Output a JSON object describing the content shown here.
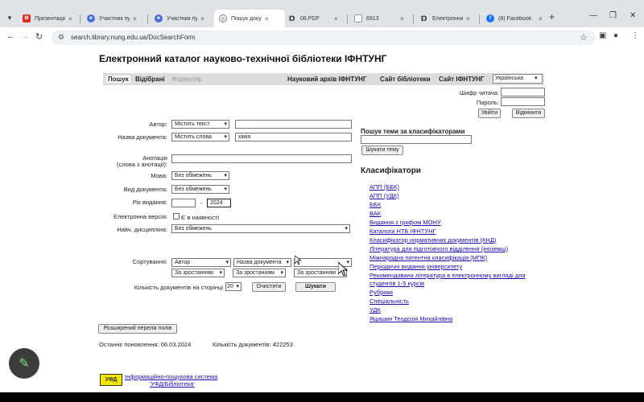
{
  "tabs": [
    {
      "title": "Презентація"
    },
    {
      "title": "Участник пуб"
    },
    {
      "title": "Участник пуб"
    },
    {
      "title": "Пошук докум",
      "active": true
    },
    {
      "title": "08.PDF"
    },
    {
      "title": "6913"
    },
    {
      "title": "Електронний"
    },
    {
      "title": "(8) Facebook"
    }
  ],
  "url": "search.library.nung.edu.ua/DocSearchForm",
  "page": {
    "title": "Електронний каталог науково-технічної бібліотеки ІФНТУНГ",
    "nav": {
      "search": "Пошук",
      "favorites": "Відібрані",
      "form": "Формуляр",
      "archive": "Науковий архів ІФНТУНГ",
      "library_site": "Сайт бібліотеки",
      "ifntung_site": "Сайт ІФНТУНГ",
      "language": "Українська"
    },
    "login": {
      "reader_code_label": "Шифр читача:",
      "password_label": "Пароль:",
      "enter": "Увійти",
      "cancel": "Відмінити"
    },
    "form": {
      "author_label": "Автор:",
      "author_mode": "Містить текст",
      "title_label": "Назва документа:",
      "title_mode": "Містить слова",
      "title_value": "хімія",
      "annotation_label": "Анотація",
      "annotation_sub": "(слова з анотації):",
      "lang_label": "Мова:",
      "lang_value": "Без обмежень",
      "doctype_label": "Вид документа:",
      "doctype_value": "Без обмежень",
      "year_label": "Рік видання:",
      "year_sep": "-",
      "year_to": "2024",
      "ebook_label": "Електронна версія:",
      "ebook_check": "Є в наявності",
      "discipline_label": "Навч. дисципліна:",
      "discipline_value": "Без обмежень",
      "sort_label": "Сортування:",
      "sort1": "Автор",
      "sort2": "Назва документа",
      "sort3": "",
      "order1": "За зростанням",
      "order2": "За зростанням",
      "order3": "За зростанням",
      "per_page_label": "Кількість документів на сторінці",
      "per_page": "20",
      "clear": "Очистити",
      "search": "Шукати",
      "extended": "Розширений перелік полів",
      "last_update": "Останнє поновлення: 06.03.2024",
      "doc_count": "Кількість документів: 422253"
    },
    "classifier_search": {
      "title": "Пошук теми за класифікаторами",
      "button": "Шукати тему"
    },
    "classifiers": {
      "title": "Класифікатори",
      "items": [
        "АПП (ББК)",
        "АПП (УДК)",
        "ББК",
        "ВАК",
        "Видання з грифом МОНУ",
        "Каталоги НТБ ІФНТУНГ",
        "Класифікатор нормативних документів (КНД)",
        "Література для підготовчого відділення (іноземці)",
        "Міжнародна патентна класифікація (МПК)",
        "Періодичні видання університету",
        "Рекомендована література в електронному вигляді для",
        "студентів 1-5 курсів",
        "Рубрики",
        "Спеціальність",
        "УДК",
        "Яцишин Теодозія Михайлівна"
      ]
    },
    "footer": {
      "logo": "УФД",
      "line1": "Інформаційно-пошукова система",
      "line2": "'УФД/Бібліотека'"
    }
  }
}
